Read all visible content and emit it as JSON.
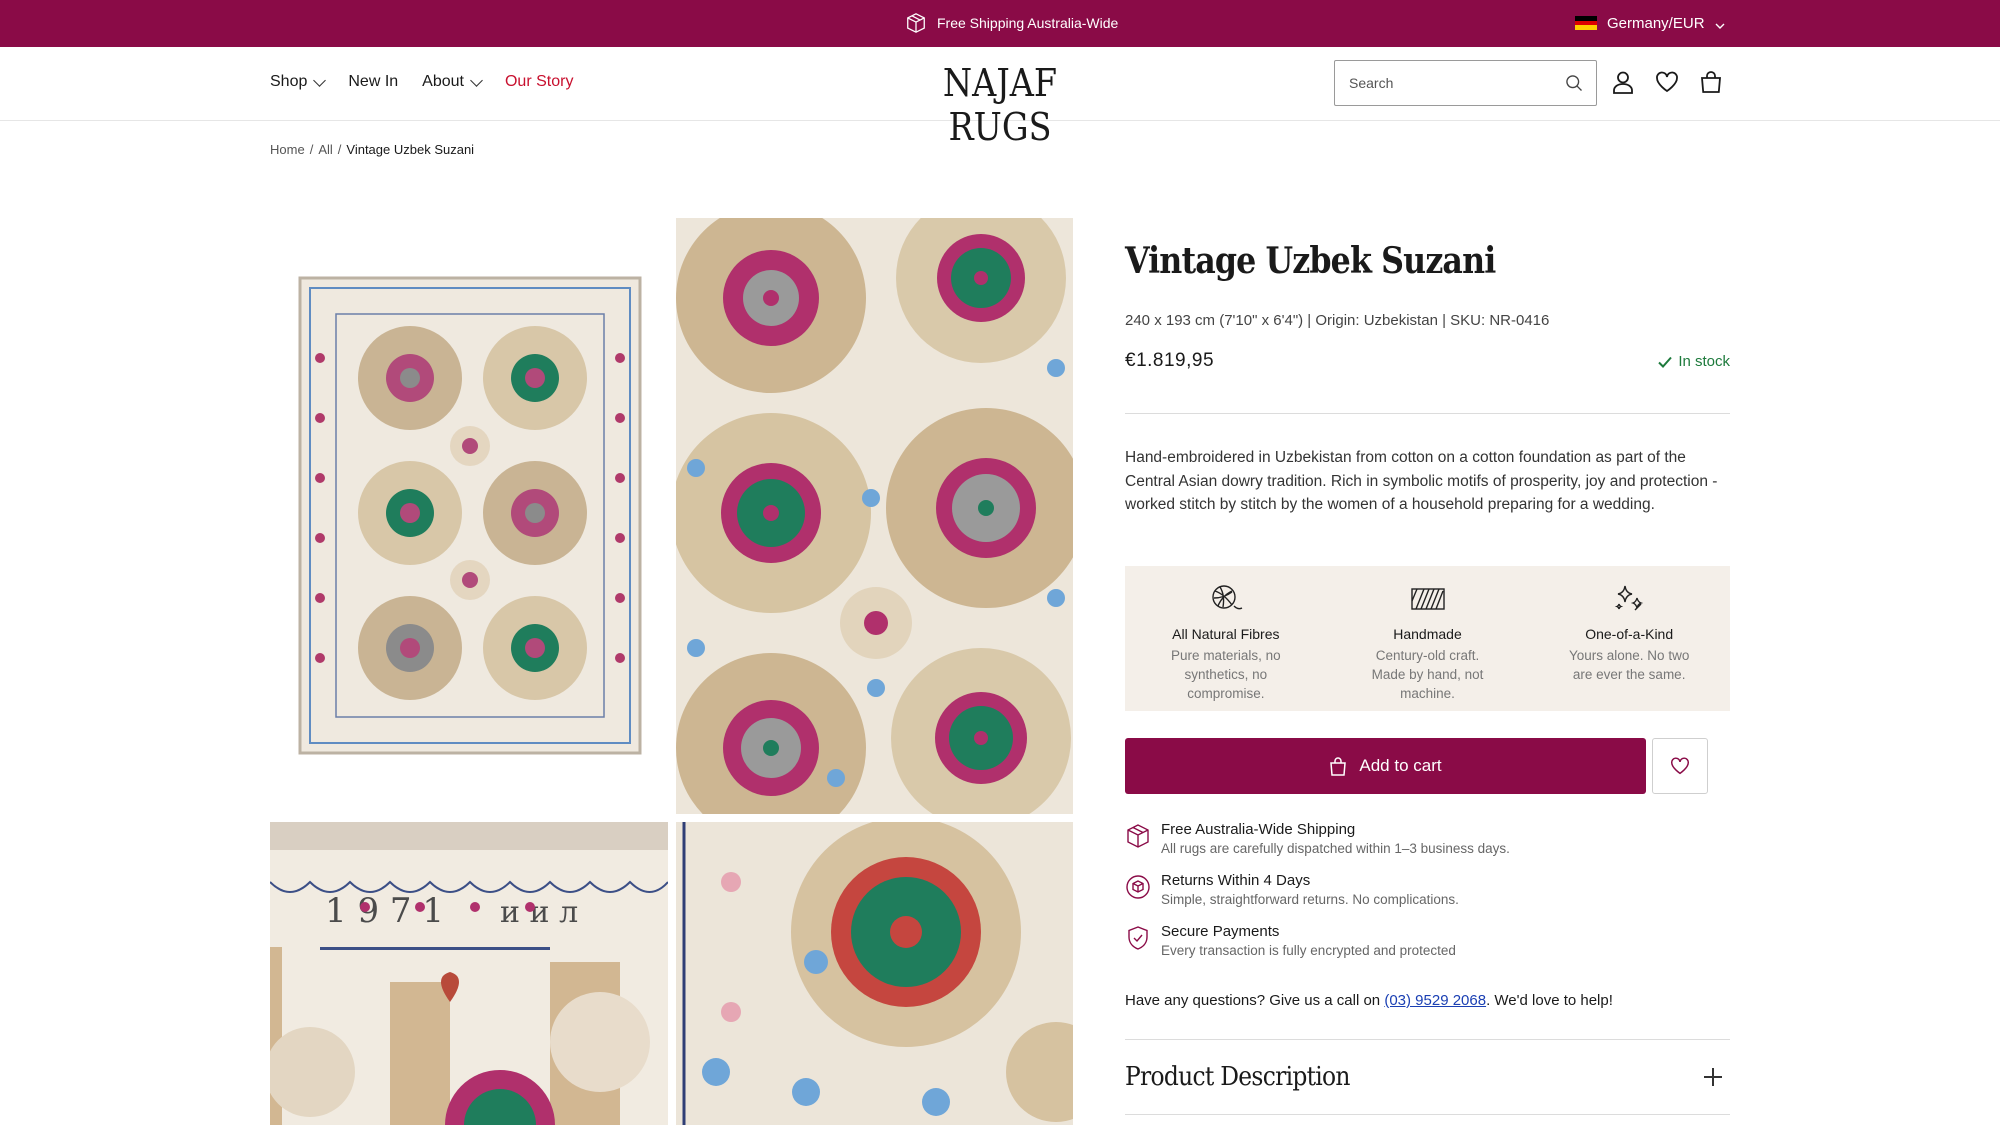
{
  "colors": {
    "brand": "#8a0b47",
    "stock": "#1d7a3c",
    "story_link": "#c8102e"
  },
  "announcement": {
    "shipping_text": "Free Shipping Australia-Wide",
    "shipping_icon": "box-icon",
    "locale": "Germany/EUR"
  },
  "header": {
    "logo": "NAJAF RUGS",
    "nav": [
      {
        "label": "Shop",
        "has_dropdown": true
      },
      {
        "label": "New In",
        "has_dropdown": false
      },
      {
        "label": "About",
        "has_dropdown": true
      },
      {
        "label": "Our Story",
        "has_dropdown": false
      }
    ],
    "search_placeholder": "Search",
    "icons": [
      "search-icon",
      "account-icon",
      "wishlist-icon",
      "cart-icon"
    ]
  },
  "breadcrumb": {
    "items": [
      "Home",
      "All"
    ],
    "separator": "/",
    "current": "Vintage Uzbek Suzani"
  },
  "product": {
    "title": "Vintage Uzbek Suzani",
    "meta": "240 x 193 cm (7'10\" x 6'4\") | Origin: Uzbekistan | SKU: NR-0416",
    "price": "€1.819,95",
    "stock": "In stock",
    "description": "Hand-embroidered in Uzbekistan from cotton on a cotton foundation as part of the Central Asian dowry tradition. Rich in symbolic motifs of prosperity, joy and protection - worked stitch by stitch by the women of a household preparing for a wedding.",
    "features": [
      {
        "icon": "yarn-ball-icon",
        "title": "All Natural Fibres",
        "text": "Pure materials, no synthetics, no compromise."
      },
      {
        "icon": "weave-icon",
        "title": "Handmade",
        "text": "Century-old craft. Made by hand, not machine."
      },
      {
        "icon": "sparkles-icon",
        "title": "One-of-a-Kind",
        "text": "Yours alone. No two are ever the same."
      }
    ],
    "add_to_cart": "Add to cart",
    "perks": [
      {
        "icon": "shipping-box-icon",
        "title": "Free Australia-Wide Shipping",
        "text": "All rugs are carefully dispatched within 1–3 business days."
      },
      {
        "icon": "returns-icon",
        "title": "Returns Within 4 Days",
        "text": "Simple, straightforward returns. No complications."
      },
      {
        "icon": "shield-check-icon",
        "title": "Secure Payments",
        "text": "Every transaction is fully encrypted and protected"
      }
    ],
    "contact_prefix": "Have any questions? Give us a call on ",
    "contact_phone": "(03) 9529 2068",
    "contact_suffix": ". We'd love to help!",
    "accordion_title": "Product Description"
  },
  "gallery": [
    "suzani-full-view",
    "suzani-detail-medallions",
    "suzani-detail-1971-border",
    "suzani-detail-green-medallion"
  ]
}
